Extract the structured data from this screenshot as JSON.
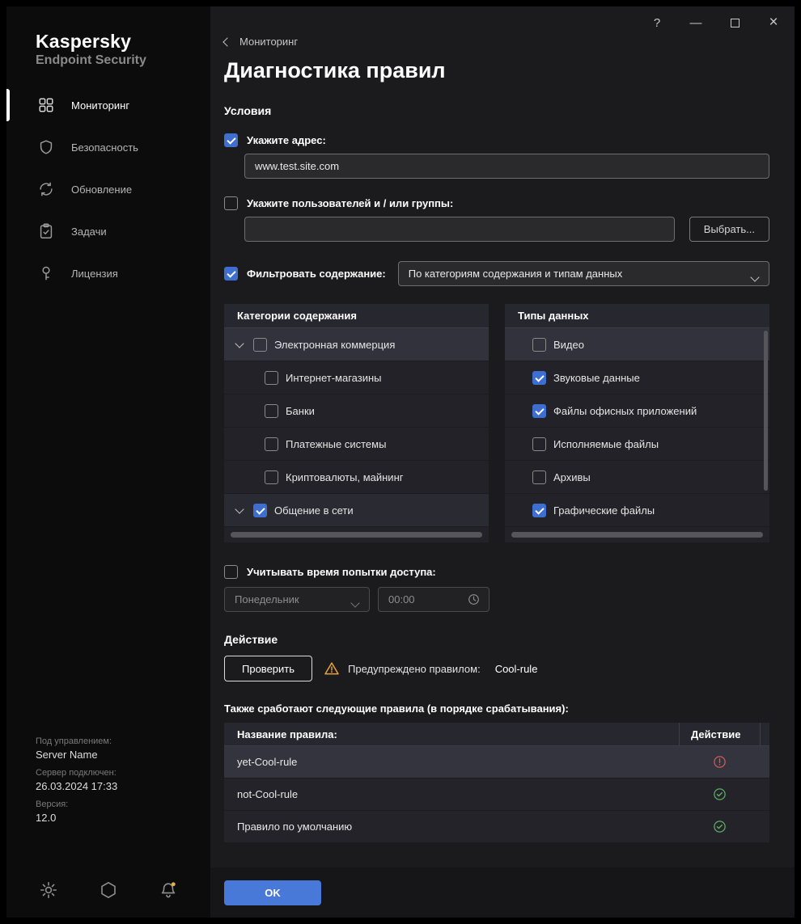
{
  "colors": {
    "accent_blue": "#3d6ed0",
    "ok_button_blue": "#4878d8",
    "warning_orange": "#e8a33d",
    "error_red": "#cf5b56",
    "success_green": "#5fae63"
  },
  "window_controls": {
    "help": "?",
    "minimize": "—",
    "close": "×"
  },
  "sidebar": {
    "brand": {
      "name": "Kaspersky",
      "product": "Endpoint Security"
    },
    "items": [
      {
        "label": "Мониторинг",
        "active": true
      },
      {
        "label": "Безопасность",
        "active": false
      },
      {
        "label": "Обновление",
        "active": false
      },
      {
        "label": "Задачи",
        "active": false
      },
      {
        "label": "Лицензия",
        "active": false
      }
    ],
    "footer": {
      "managed_label": "Под управлением:",
      "server_name": "Server Name",
      "connected_label": "Сервер подключен:",
      "connected_value": "26.03.2024 17:33",
      "version_label": "Версия:",
      "version_value": "12.0"
    }
  },
  "header": {
    "back_label": "Мониторинг",
    "title": "Диагностика правил"
  },
  "conditions": {
    "section_title": "Условия",
    "address": {
      "label": "Укажите адрес:",
      "checked": true,
      "value": "www.test.site.com"
    },
    "users": {
      "label": "Укажите пользователей и / или группы:",
      "checked": false,
      "value": "",
      "button_label": "Выбрать..."
    },
    "filter": {
      "label": "Фильтровать содержание:",
      "checked": true,
      "select_value": "По категориям содержания и типам данных"
    },
    "categories_panel": {
      "title": "Категории содержания",
      "items": [
        {
          "label": "Электронная коммерция",
          "checked": false
        },
        {
          "label": "Интернет-магазины",
          "checked": false
        },
        {
          "label": "Банки",
          "checked": false
        },
        {
          "label": "Платежные системы",
          "checked": false
        },
        {
          "label": "Криптовалюты, майнинг",
          "checked": false
        },
        {
          "label": "Общение в сети",
          "checked": true
        }
      ]
    },
    "types_panel": {
      "title": "Типы данных",
      "items": [
        {
          "label": "Видео",
          "checked": false
        },
        {
          "label": "Звуковые данные",
          "checked": true
        },
        {
          "label": "Файлы офисных приложений",
          "checked": true
        },
        {
          "label": "Исполняемые файлы",
          "checked": false
        },
        {
          "label": "Архивы",
          "checked": false
        },
        {
          "label": "Графические файлы",
          "checked": true
        }
      ]
    },
    "time": {
      "label": "Учитывать время попытки доступа:",
      "checked": false,
      "day_value": "Понедельник",
      "time_value": "00:00"
    }
  },
  "action": {
    "section_title": "Действие",
    "check_button_label": "Проверить",
    "warning_text": "Предупреждено правилом:",
    "warning_rule": "Cool-rule",
    "table_intro": "Также сработают следующие правила (в порядке срабатывания):",
    "table": {
      "headers": {
        "name": "Название правила:",
        "action": "Действие"
      },
      "rows": [
        {
          "name": "yet-Cool-rule",
          "status": "error"
        },
        {
          "name": "not-Cool-rule",
          "status": "success"
        },
        {
          "name": "Правило по умолчанию",
          "status": "success"
        }
      ]
    }
  },
  "footer": {
    "ok_button_label": "OK"
  }
}
